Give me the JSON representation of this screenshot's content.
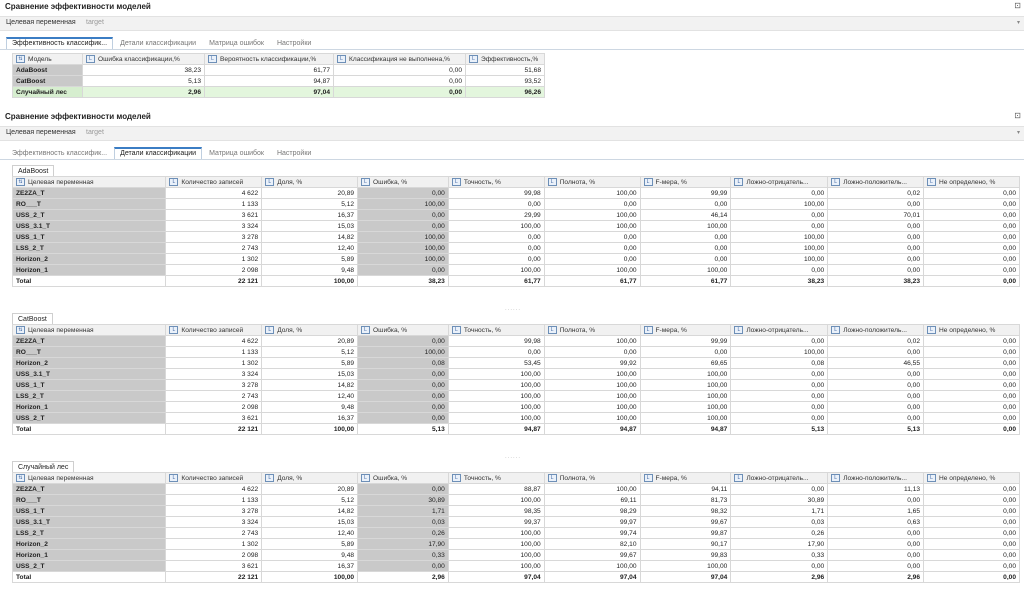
{
  "panels": [
    {
      "title": "Сравнение эффективности моделей",
      "target_label": "Целевая переменная",
      "target_placeholder": "target",
      "tabs": [
        "Эффективность классифик...",
        "Детали классификации",
        "Матрица ошибок",
        "Настройки"
      ],
      "active_tab": 0
    },
    {
      "title": "Сравнение эффективности моделей",
      "target_label": "Целевая переменная",
      "target_placeholder": "target",
      "tabs": [
        "Эффективность классифик...",
        "Детали классификации",
        "Матрица ошибок",
        "Настройки"
      ],
      "active_tab": 1
    }
  ],
  "summary": {
    "headers": [
      "Модель",
      "Ошибка классификации,%",
      "Вероятность классификации,%",
      "Классификация не выполнена,%",
      "Эффективность,%"
    ],
    "rows": [
      [
        "AdaBoost",
        "38,23",
        "61,77",
        "0,00",
        "51,68"
      ],
      [
        "CatBoost",
        "5,13",
        "94,87",
        "0,00",
        "93,52"
      ],
      [
        "Случайный лес",
        "2,96",
        "97,04",
        "0,00",
        "96,26"
      ]
    ]
  },
  "details_headers": [
    "Целевая переменная",
    "Количество записей",
    "Доля, %",
    "Ошибка, %",
    "Точность, %",
    "Полнота, %",
    "F-мера, %",
    "Ложно-отрицатель...",
    "Ложно-положитель...",
    "Не определено, %"
  ],
  "models": [
    {
      "name": "AdaBoost",
      "rows": [
        [
          "ZE2ZA_T",
          "4 622",
          "20,89",
          "0,00",
          "99,98",
          "100,00",
          "99,99",
          "0,00",
          "0,02",
          "0,00"
        ],
        [
          "RO___T",
          "1 133",
          "5,12",
          "100,00",
          "0,00",
          "0,00",
          "0,00",
          "100,00",
          "0,00",
          "0,00"
        ],
        [
          "USS_2_T",
          "3 621",
          "16,37",
          "0,00",
          "29,99",
          "100,00",
          "46,14",
          "0,00",
          "70,01",
          "0,00"
        ],
        [
          "USS_3.1_T",
          "3 324",
          "15,03",
          "0,00",
          "100,00",
          "100,00",
          "100,00",
          "0,00",
          "0,00",
          "0,00"
        ],
        [
          "USS_1_T",
          "3 278",
          "14,82",
          "100,00",
          "0,00",
          "0,00",
          "0,00",
          "100,00",
          "0,00",
          "0,00"
        ],
        [
          "LSS_2_T",
          "2 743",
          "12,40",
          "100,00",
          "0,00",
          "0,00",
          "0,00",
          "100,00",
          "0,00",
          "0,00"
        ],
        [
          "Horizon_2",
          "1 302",
          "5,89",
          "100,00",
          "0,00",
          "0,00",
          "0,00",
          "100,00",
          "0,00",
          "0,00"
        ],
        [
          "Horizon_1",
          "2 098",
          "9,48",
          "0,00",
          "100,00",
          "100,00",
          "100,00",
          "0,00",
          "0,00",
          "0,00"
        ]
      ],
      "total": [
        "Total",
        "22 121",
        "100,00",
        "38,23",
        "61,77",
        "61,77",
        "61,77",
        "38,23",
        "38,23",
        "0,00"
      ]
    },
    {
      "name": "CatBoost",
      "rows": [
        [
          "ZE2ZA_T",
          "4 622",
          "20,89",
          "0,00",
          "99,98",
          "100,00",
          "99,99",
          "0,00",
          "0,02",
          "0,00"
        ],
        [
          "RO___T",
          "1 133",
          "5,12",
          "100,00",
          "0,00",
          "0,00",
          "0,00",
          "100,00",
          "0,00",
          "0,00"
        ],
        [
          "Horizon_2",
          "1 302",
          "5,89",
          "0,08",
          "53,45",
          "99,92",
          "69,65",
          "0,08",
          "46,55",
          "0,00"
        ],
        [
          "USS_3.1_T",
          "3 324",
          "15,03",
          "0,00",
          "100,00",
          "100,00",
          "100,00",
          "0,00",
          "0,00",
          "0,00"
        ],
        [
          "USS_1_T",
          "3 278",
          "14,82",
          "0,00",
          "100,00",
          "100,00",
          "100,00",
          "0,00",
          "0,00",
          "0,00"
        ],
        [
          "LSS_2_T",
          "2 743",
          "12,40",
          "0,00",
          "100,00",
          "100,00",
          "100,00",
          "0,00",
          "0,00",
          "0,00"
        ],
        [
          "Horizon_1",
          "2 098",
          "9,48",
          "0,00",
          "100,00",
          "100,00",
          "100,00",
          "0,00",
          "0,00",
          "0,00"
        ],
        [
          "USS_2_T",
          "3 621",
          "16,37",
          "0,00",
          "100,00",
          "100,00",
          "100,00",
          "0,00",
          "0,00",
          "0,00"
        ]
      ],
      "total": [
        "Total",
        "22 121",
        "100,00",
        "5,13",
        "94,87",
        "94,87",
        "94,87",
        "5,13",
        "5,13",
        "0,00"
      ]
    },
    {
      "name": "Случайный лес",
      "rows": [
        [
          "ZE2ZA_T",
          "4 622",
          "20,89",
          "0,00",
          "88,87",
          "100,00",
          "94,11",
          "0,00",
          "11,13",
          "0,00"
        ],
        [
          "RO___T",
          "1 133",
          "5,12",
          "30,89",
          "100,00",
          "69,11",
          "81,73",
          "30,89",
          "0,00",
          "0,00"
        ],
        [
          "USS_1_T",
          "3 278",
          "14,82",
          "1,71",
          "98,35",
          "98,29",
          "98,32",
          "1,71",
          "1,65",
          "0,00"
        ],
        [
          "USS_3.1_T",
          "3 324",
          "15,03",
          "0,03",
          "99,37",
          "99,97",
          "99,67",
          "0,03",
          "0,63",
          "0,00"
        ],
        [
          "LSS_2_T",
          "2 743",
          "12,40",
          "0,26",
          "100,00",
          "99,74",
          "99,87",
          "0,26",
          "0,00",
          "0,00"
        ],
        [
          "Horizon_2",
          "1 302",
          "5,89",
          "17,90",
          "100,00",
          "82,10",
          "90,17",
          "17,90",
          "0,00",
          "0,00"
        ],
        [
          "Horizon_1",
          "2 098",
          "9,48",
          "0,33",
          "100,00",
          "99,67",
          "99,83",
          "0,33",
          "0,00",
          "0,00"
        ],
        [
          "USS_2_T",
          "3 621",
          "16,37",
          "0,00",
          "100,00",
          "100,00",
          "100,00",
          "0,00",
          "0,00",
          "0,00"
        ]
      ],
      "total": [
        "Total",
        "22 121",
        "100,00",
        "2,96",
        "97,04",
        "97,04",
        "97,04",
        "2,96",
        "2,96",
        "0,00"
      ]
    }
  ]
}
